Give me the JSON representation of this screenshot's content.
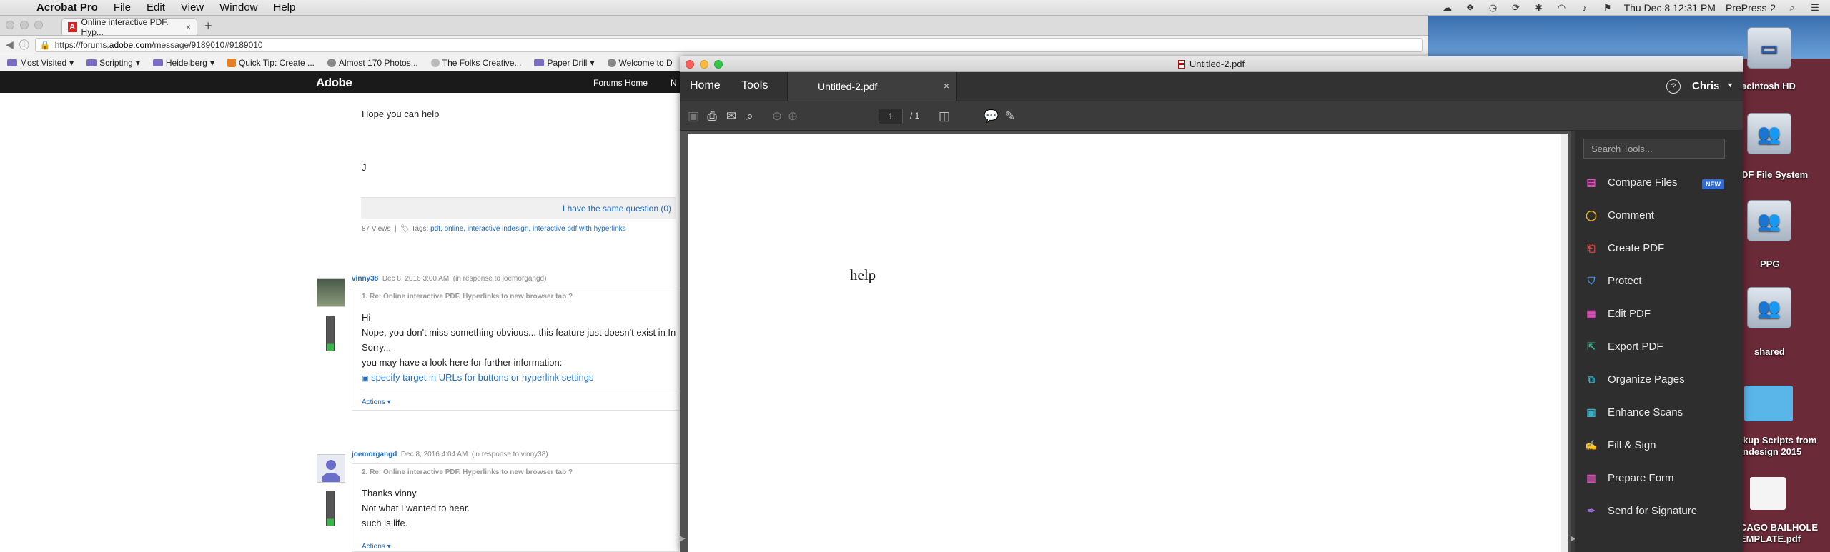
{
  "menubar": {
    "app": "Acrobat Pro",
    "items": [
      "File",
      "Edit",
      "View",
      "Window",
      "Help"
    ],
    "datetime": "Thu Dec 8  12:31 PM",
    "user": "PrePress-2"
  },
  "browser": {
    "tab_title": "Online interactive PDF. Hyp...",
    "url_prefix": "https://forums.",
    "url_domain": "adobe.com",
    "url_path": "/message/9189010#9189010",
    "bookmarks": [
      "Most Visited",
      "Scripting",
      "Heidelberg",
      "Quick Tip: Create ...",
      "Almost 170 Photos...",
      "The Folks Creative...",
      "Paper Drill",
      "Welcome to D"
    ],
    "site_logo": "Adobe",
    "site_nav": [
      "Forums Home",
      "N"
    ]
  },
  "forum": {
    "hope": "Hope you can help",
    "sig": "J",
    "same_question": "I have the same question (0)",
    "views": "87 Views",
    "tags_label": "Tags:",
    "tags": "pdf, online, interactive indesign, interactive pdf with hyperlinks",
    "post1": {
      "user": "vinny38",
      "date": "Dec 8, 2016 3:00 AM",
      "in_response": "(in response to joemorgangd)",
      "title": "1. Re: Online interactive PDF. Hyperlinks to new browser tab ?",
      "lines": [
        "Hi",
        "Nope, you don't miss something obvious... this feature just doesn't exist in In",
        "Sorry...",
        "you may have a look here for further information:"
      ],
      "link": "specify target in URLs for buttons or hyperlink settings",
      "actions": "Actions"
    },
    "post2": {
      "user": "joemorgangd",
      "date": "Dec 8, 2016 4:04 AM",
      "in_response": "(in response to vinny38)",
      "title": "2. Re: Online interactive PDF. Hyperlinks to new browser tab ?",
      "lines": [
        "Thanks vinny.",
        "Not what I wanted to hear.",
        "such is life."
      ],
      "actions": "Actions"
    }
  },
  "acrobat": {
    "window_title": "Untitled-2.pdf",
    "nav_home": "Home",
    "nav_tools": "Tools",
    "doc_tab": "Untitled-2.pdf",
    "user": "Chris",
    "page_current": "1",
    "page_total": "/ 1",
    "pdf_text": "help",
    "search_placeholder": "Search Tools...",
    "new_badge": "NEW",
    "tools": [
      {
        "label": "Compare Files",
        "color": "#d94fb6",
        "icon": "compare-files-icon"
      },
      {
        "label": "Comment",
        "color": "#e8b51a",
        "icon": "comment-icon"
      },
      {
        "label": "Create PDF",
        "color": "#e0463f",
        "icon": "create-pdf-icon"
      },
      {
        "label": "Protect",
        "color": "#4a8fe0",
        "icon": "protect-icon"
      },
      {
        "label": "Edit PDF",
        "color": "#d94fb6",
        "icon": "edit-pdf-icon"
      },
      {
        "label": "Export PDF",
        "color": "#3ab08e",
        "icon": "export-pdf-icon"
      },
      {
        "label": "Organize Pages",
        "color": "#3ab0c8",
        "icon": "organize-pages-icon"
      },
      {
        "label": "Enhance Scans",
        "color": "#3ab0c8",
        "icon": "enhance-scans-icon"
      },
      {
        "label": "Fill & Sign",
        "color": "#9a6ee0",
        "icon": "fill-sign-icon"
      },
      {
        "label": "Prepare Form",
        "color": "#d94fb6",
        "icon": "prepare-form-icon"
      },
      {
        "label": "Send for Signature",
        "color": "#9a6ee0",
        "icon": "send-for-signature-icon"
      }
    ]
  },
  "desktop": {
    "items": [
      "acintosh HD",
      "DF File System",
      "PPG",
      "shared",
      "kup Scripts from",
      "ndesign 2015",
      "CAGO BAILHOLE",
      "EMPLATE.pdf"
    ]
  }
}
